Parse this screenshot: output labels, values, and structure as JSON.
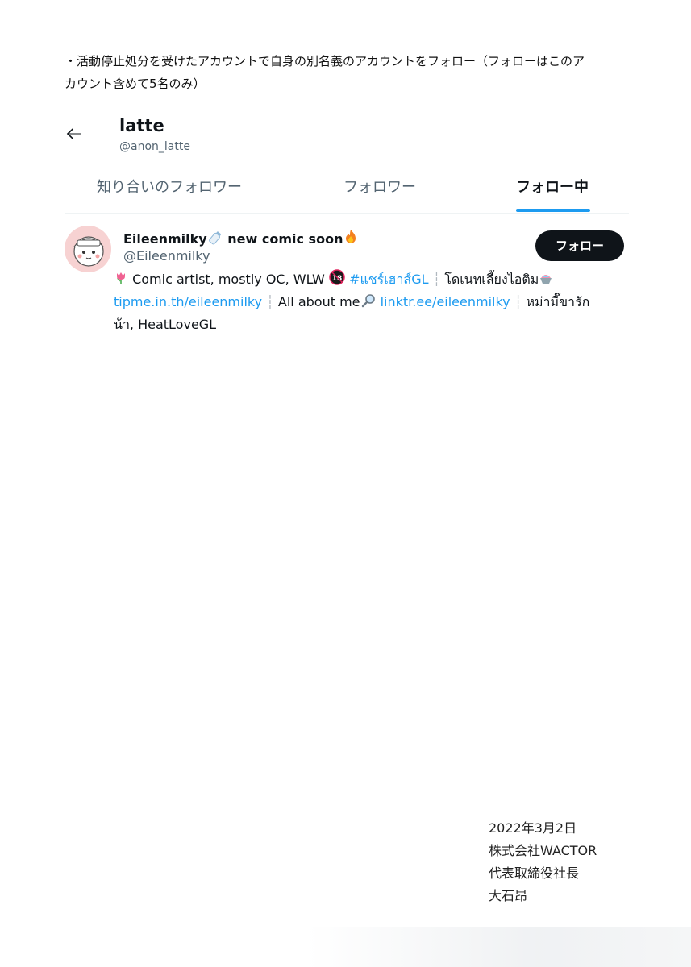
{
  "intro": {
    "line1": "・活動停止処分を受けたアカウントで自身の別名義のアカウントをフォロー（フォローはこのア",
    "line2": "カウント含めて5名のみ）"
  },
  "profile": {
    "name": "latte",
    "handle": "@anon_latte"
  },
  "tabs": [
    {
      "label": "知り合いのフォロワー"
    },
    {
      "label": "フォロワー"
    },
    {
      "label": "フォロー中"
    }
  ],
  "user": {
    "name": "Eileenmilky",
    "name_suffix": " new comic soon",
    "handle": "@Eileenmilky",
    "follow_label": "フォロー",
    "bio": {
      "l1_text1": " Comic artist, mostly OC, WLW ",
      "l1_hashtag": "#แชร์เฮาส์GL",
      "l1_sep": " ┆ ",
      "l1_text2": "โดเนทเลี้ยงไอติม",
      "l2_link1": "tipme.in.th/eileenmilky",
      "l2_sep1": " ┆ ",
      "l2_text": "All about me",
      "l2_link2": "linktr.ee/eileenmilky",
      "l2_sep2": " ┆ ",
      "l2_text2": "หม่ามี๊ขารัก",
      "l3_text": "น้า, HeatLoveGL"
    }
  },
  "signature": {
    "date": "2022年3月2日",
    "company": "株式会社WACTOR",
    "title": "代表取締役社長",
    "name": "大石昂"
  }
}
